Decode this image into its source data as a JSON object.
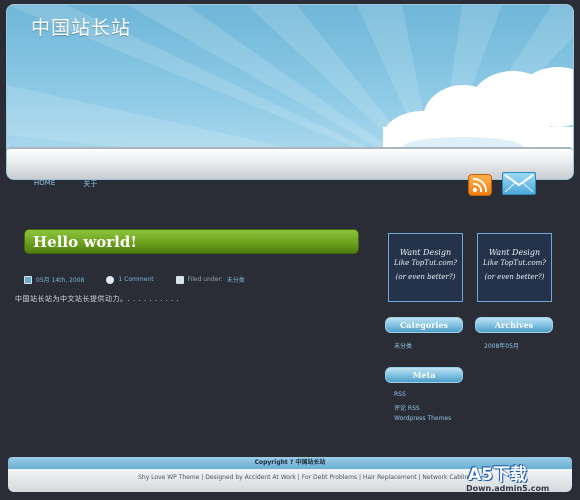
{
  "header": {
    "site_title": "中国站长站"
  },
  "nav": {
    "items": [
      "HOME",
      "关于"
    ]
  },
  "post": {
    "title": "Hello world!",
    "date": "05月 14th, 2008",
    "comment": "1 Comment",
    "filed_label": "Filed under:",
    "category": "未分类",
    "body": "中国站长站为中文站长提供动力。. . . . . . . . . ."
  },
  "ads": {
    "line1": "Want Design",
    "line2": "Like TopTut.com?",
    "line3": "(or even better?)"
  },
  "sidebar": {
    "categories": {
      "title": "Categories",
      "items": [
        "未分类"
      ]
    },
    "archives": {
      "title": "Archives",
      "items": [
        "2008年05月"
      ]
    },
    "meta": {
      "title": "Meta",
      "items": [
        "RSS",
        "评论 RSS",
        "Wordpress Themes"
      ]
    }
  },
  "footer": {
    "copyright": "Copyright ? 中国站长站",
    "links": [
      "Shy Love WP Theme",
      "Designed by Accident At Work",
      "For Debt Problems",
      "Hair Replacement",
      "Network Cabling"
    ]
  },
  "watermark": {
    "main": "A5下载",
    "sub": "Down.admin5.com"
  },
  "icons": {
    "rss": "rss-feed-icon",
    "mail": "mail-envelope-icon"
  },
  "colors": {
    "accent_green": "#6da21f",
    "link_blue": "#8ec5e4",
    "background": "#2a2d36"
  }
}
